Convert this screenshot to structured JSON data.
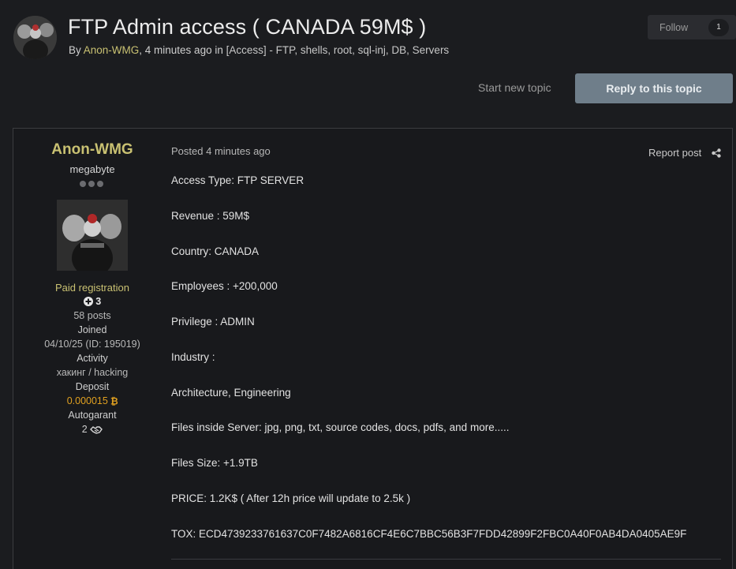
{
  "topic": {
    "title": "FTP Admin access ( CANADA 59M$ )",
    "meta_prefix": "By ",
    "author": "Anon-WMG",
    "meta_time": ", 4 minutes ago in ",
    "forum": "[Access] - FTP, shells, root, sql-inj, DB, Servers",
    "follow_label": "Follow",
    "follow_count": "1"
  },
  "actions": {
    "start_new_topic": "Start new topic",
    "reply": "Reply to this topic"
  },
  "author_panel": {
    "name": "Anon-WMG",
    "rank": "megabyte",
    "group": "Paid registration",
    "reputation": "3",
    "posts": "58 posts",
    "joined_label": "Joined",
    "joined_value": "04/10/25 (ID: 195019)",
    "activity_label": "Activity",
    "activity_value": "хакинг / hacking",
    "deposit_label": "Deposit",
    "deposit_value": "0.000015",
    "autogarant_label": "Autogarant",
    "autogarant_value": "2"
  },
  "post": {
    "posted_label": "Posted",
    "posted_time": "4 minutes ago",
    "report": "Report post",
    "lines": [
      "Access Type: FTP SERVER",
      "Revenue : 59M$",
      "Country: CANADA",
      "Employees : +200,000",
      "Privilege : ADMIN",
      "Industry :",
      "Architecture, Engineering",
      "Files inside Server: jpg, png, txt, source codes, docs, pdfs, and more.....",
      "Files Size: +1.9TB",
      "PRICE: 1.2K$ ( After 12h price will update to 2.5k )",
      "TOX: ECD4739233761637C0F7482A6816CF4E6C7BBC56B3F7FDD42899F2FBC0A40F0AB4DA0405AE9F"
    ]
  },
  "colors": {
    "accent_author": "#c9c172",
    "reply_button": "#6f7e8a",
    "bitcoin": "#e0a020"
  },
  "icons": [
    "plus-circle-icon",
    "bitcoin-icon",
    "handshake-icon",
    "share-icon"
  ]
}
